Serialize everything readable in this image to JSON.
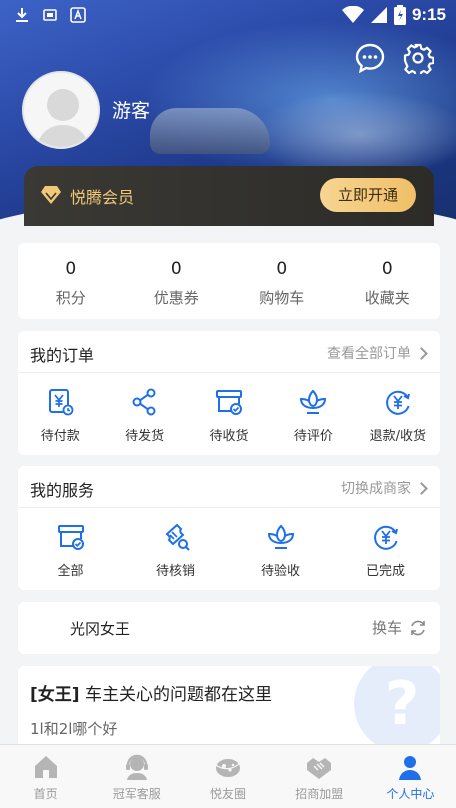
{
  "status_bar": {
    "time": "9:15"
  },
  "profile": {
    "name": "游客"
  },
  "membership": {
    "label": "悦腾会员",
    "button": "立即开通"
  },
  "stats": [
    {
      "value": "0",
      "label": "积分"
    },
    {
      "value": "0",
      "label": "优惠券"
    },
    {
      "value": "0",
      "label": "购物车"
    },
    {
      "value": "0",
      "label": "收藏夹"
    }
  ],
  "orders": {
    "title": "我的订单",
    "more": "查看全部订单",
    "items": [
      {
        "label": "待付款",
        "icon": "bill-yen-icon"
      },
      {
        "label": "待发货",
        "icon": "share-icon"
      },
      {
        "label": "待收货",
        "icon": "box-check-icon"
      },
      {
        "label": "待评价",
        "icon": "flower-icon"
      },
      {
        "label": "退款/收货",
        "icon": "refund-yen-icon"
      }
    ]
  },
  "services": {
    "title": "我的服务",
    "more": "切换成商家",
    "items": [
      {
        "label": "全部",
        "icon": "box-check-icon"
      },
      {
        "label": "待核销",
        "icon": "ticket-search-icon"
      },
      {
        "label": "待验收",
        "icon": "flower-icon"
      },
      {
        "label": "已完成",
        "icon": "refund-yen-icon"
      }
    ]
  },
  "car": {
    "name": "光冈女王",
    "swap": "换车"
  },
  "faq": {
    "tag": "[女王]",
    "question": " 车主关心的问题都在这里",
    "sub": "1l和2l哪个好"
  },
  "tabs": [
    {
      "label": "首页",
      "icon": "home-icon"
    },
    {
      "label": "冠军客服",
      "icon": "support-icon"
    },
    {
      "label": "悦友圈",
      "icon": "planet-icon"
    },
    {
      "label": "招商加盟",
      "icon": "handshake-icon"
    },
    {
      "label": "个人中心",
      "icon": "person-icon",
      "active": true
    }
  ],
  "colors": {
    "accent": "#1e6fe8",
    "gold": "#f1c878"
  }
}
